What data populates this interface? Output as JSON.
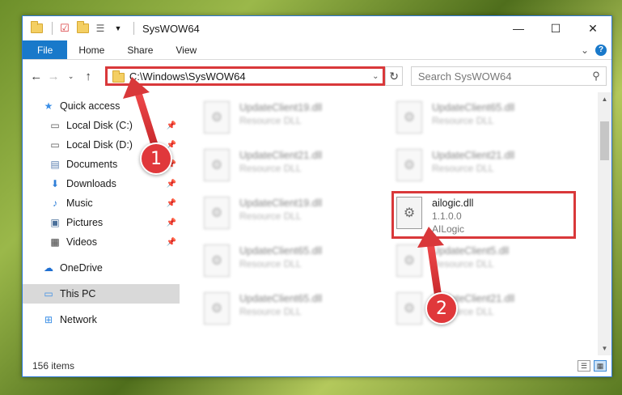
{
  "window": {
    "title": "SysWOW64",
    "controls": {
      "minimize": "—",
      "maximize": "☐",
      "close": "✕"
    }
  },
  "ribbon": {
    "tabs": [
      "File",
      "Home",
      "Share",
      "View"
    ],
    "expand": "⌄",
    "help": "?"
  },
  "address_bar": {
    "path": "C:\\Windows\\SysWOW64"
  },
  "search": {
    "placeholder": "Search SysWOW64"
  },
  "sidebar": {
    "items": [
      {
        "label": "Quick access",
        "icon": "star-icon"
      },
      {
        "label": "Local Disk (C:)",
        "icon": "drive-icon",
        "pinned": true
      },
      {
        "label": "Local Disk (D:)",
        "icon": "drive-icon",
        "pinned": true
      },
      {
        "label": "Documents",
        "icon": "documents-icon",
        "pinned": true
      },
      {
        "label": "Downloads",
        "icon": "download-icon",
        "pinned": true
      },
      {
        "label": "Music",
        "icon": "music-icon",
        "pinned": true
      },
      {
        "label": "Pictures",
        "icon": "pictures-icon",
        "pinned": true
      },
      {
        "label": "Videos",
        "icon": "videos-icon",
        "pinned": true
      },
      {
        "label": "OneDrive",
        "icon": "cloud-icon"
      },
      {
        "label": "This PC",
        "icon": "computer-icon",
        "selected": true
      },
      {
        "label": "Network",
        "icon": "network-icon"
      }
    ]
  },
  "files": [
    {
      "name": "UpdateClient19.dll",
      "type": "Resource DLL",
      "blurred": true
    },
    {
      "name": "UpdateClient65.dll",
      "type": "Resource DLL",
      "blurred": true
    },
    {
      "name": "UpdateClient21.dll",
      "type": "Resource DLL",
      "blurred": true
    },
    {
      "name": "UpdateClient21.dll",
      "type": "Resource DLL",
      "blurred": true
    },
    {
      "name": "UpdateClient19.dll",
      "type": "Resource DLL",
      "blurred": true
    },
    {
      "name": "ailogic.dll",
      "version": "1.1.0.0",
      "company": "AILogic",
      "highlighted": true
    },
    {
      "name": "UpdateClient65.dll",
      "type": "Resource DLL",
      "blurred": true
    },
    {
      "name": "UpdateClient5.dll",
      "type": "Resource DLL",
      "blurred": true
    },
    {
      "name": "UpdateClient65.dll",
      "type": "Resource DLL",
      "blurred": true
    },
    {
      "name": "UpdateClient21.dll",
      "type": "Resource DLL",
      "blurred": true
    }
  ],
  "status": {
    "item_count": "156 items"
  },
  "annotations": {
    "step1": "1",
    "step2": "2",
    "color": "#e0383b"
  }
}
